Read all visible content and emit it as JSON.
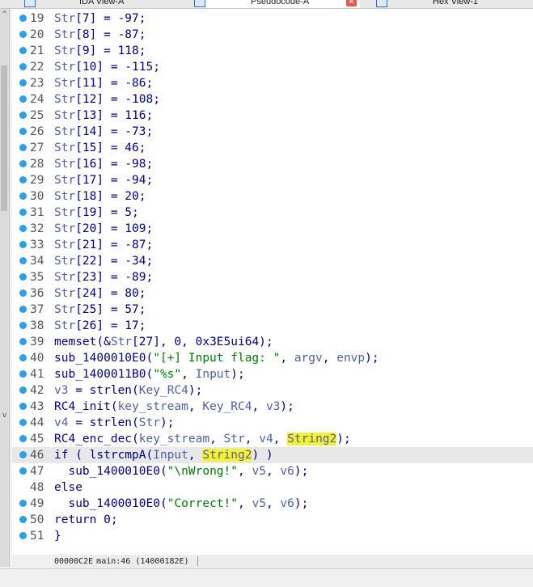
{
  "tabs": [
    {
      "label": "IDA View-A",
      "icon": "ida-view-icon",
      "active": false
    },
    {
      "label": "Pseudocode-A",
      "icon": "pseudocode-icon",
      "active": true
    },
    {
      "label": "Hex View-1",
      "icon": "hex-view-icon",
      "active": false
    }
  ],
  "lines": [
    {
      "num": "19",
      "code": "Str[7] = -97;"
    },
    {
      "num": "20",
      "code": "Str[8] = -87;"
    },
    {
      "num": "21",
      "code": "Str[9] = 118;"
    },
    {
      "num": "22",
      "code": "Str[10] = -115;"
    },
    {
      "num": "23",
      "code": "Str[11] = -86;"
    },
    {
      "num": "24",
      "code": "Str[12] = -108;"
    },
    {
      "num": "25",
      "code": "Str[13] = 116;"
    },
    {
      "num": "26",
      "code": "Str[14] = -73;"
    },
    {
      "num": "27",
      "code": "Str[15] = 46;"
    },
    {
      "num": "28",
      "code": "Str[16] = -98;"
    },
    {
      "num": "29",
      "code": "Str[17] = -94;"
    },
    {
      "num": "30",
      "code": "Str[18] = 20;"
    },
    {
      "num": "31",
      "code": "Str[19] = 5;"
    },
    {
      "num": "32",
      "code": "Str[20] = 109;"
    },
    {
      "num": "33",
      "code": "Str[21] = -87;"
    },
    {
      "num": "34",
      "code": "Str[22] = -34;"
    },
    {
      "num": "35",
      "code": "Str[23] = -89;"
    },
    {
      "num": "36",
      "code": "Str[24] = 80;"
    },
    {
      "num": "37",
      "code": "Str[25] = 57;"
    },
    {
      "num": "38",
      "code": "Str[26] = 17;"
    },
    {
      "num": "39",
      "code": "memset(&Str[27], 0, 0x3E5ui64);"
    },
    {
      "num": "40",
      "code": "sub_1400010E0(\"[+] Input flag: \", argv, envp);"
    },
    {
      "num": "41",
      "code": "sub_1400011B0(\"%s\", Input);"
    },
    {
      "num": "42",
      "code": "v3 = strlen(Key_RC4);"
    },
    {
      "num": "43",
      "code": "RC4_init(key_stream, Key_RC4, v3);"
    },
    {
      "num": "44",
      "code": "v4 = strlen(Str);"
    },
    {
      "num": "45",
      "code": "RC4_enc_dec(key_stream, Str, v4, String2);"
    },
    {
      "num": "46",
      "code": "if ( lstrcmpA(Input, String2) )"
    },
    {
      "num": "47",
      "code": "  sub_1400010E0(\"\\nWrong!\", v5, v6);"
    },
    {
      "num": "48",
      "code": "else"
    },
    {
      "num": "49",
      "code": "  sub_1400010E0(\"Correct!\", v5, v6);"
    },
    {
      "num": "50",
      "code": "return 0;"
    },
    {
      "num": "51",
      "code": "}"
    }
  ],
  "status": {
    "address": "00000C2E",
    "location": "main:46 (14000182E)"
  },
  "colors": {
    "breakpoint_dot": "#2aa0e8",
    "keyword": "#000080",
    "variable": "#4f5fa8",
    "string": "#007800",
    "highlight": "#f5f032",
    "current_line": "#e8e8e8"
  }
}
